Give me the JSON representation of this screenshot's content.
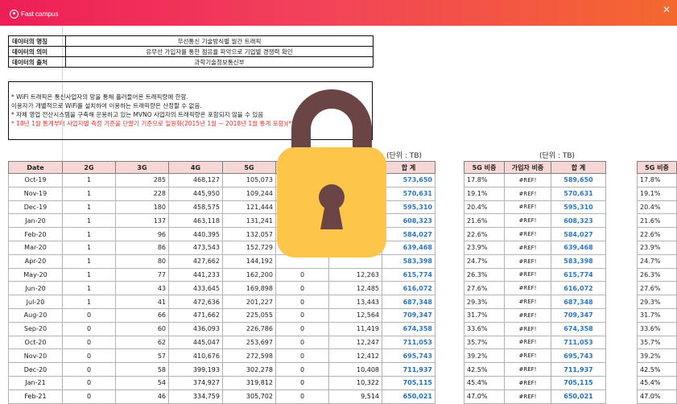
{
  "header": {
    "brand": "Fast campus",
    "close_glyph": "✕",
    "colors": {
      "start": "#ee1e58",
      "end": "#f4682f"
    }
  },
  "info": [
    {
      "key": "데이터의 명칭",
      "value": "무선통신 기술방식별 월간 트래픽"
    },
    {
      "key": "데이터의 의미",
      "value": "유무선 가입자를 통한 점유율 파악으로 기업별 경쟁력 확인"
    },
    {
      "key": "데이터의 출처",
      "value": "과학기술정보통신부"
    }
  ],
  "notes": {
    "line1": "* WiFi 트래픽은 통신사업자의 망을 통해 흘러들어온 트래픽량에 한함.",
    "line2": "이용자가 개별적으로 WiFi를 설치하여 이용하는 트래픽량은 산정할 수 없음.",
    "line3": "* 자체 영업 전산시스템을 구축해 운용하고 있는 MVNO 사업자의 트래픽량은 포함되지 않을 수 있음",
    "line4": "* 18년 1월 통계부터 사업자별 측정 기준을 단말기 기준으로 일원화(2015년 1월 ~ 2018년 1월 통계 포함)(*8)"
  },
  "units": {
    "u1": "(단위 : TB)",
    "u2": "(단위 : TB)"
  },
  "table1": {
    "headers": [
      "Date",
      "2G",
      "3G",
      "4G",
      "5G",
      "",
      "",
      "합 계"
    ],
    "rows": [
      [
        "Oct-19",
        "1",
        "285",
        "468,127",
        "105,073",
        "",
        "",
        "573,650"
      ],
      [
        "Nov-19",
        "1",
        "228",
        "445,950",
        "109,244",
        "",
        "",
        "570,631"
      ],
      [
        "Dec-19",
        "1",
        "180",
        "458,575",
        "121,444",
        "",
        "",
        "595,310"
      ],
      [
        "Jan-20",
        "1",
        "137",
        "463,118",
        "131,241",
        "",
        "",
        "608,323"
      ],
      [
        "Feb-20",
        "1",
        "96",
        "440,395",
        "132,057",
        "",
        "",
        "584,027"
      ],
      [
        "Mar-20",
        "1",
        "86",
        "473,543",
        "152,729",
        "",
        "",
        "639,468"
      ],
      [
        "Apr-20",
        "1",
        "80",
        "427,662",
        "144,192",
        "",
        "",
        "583,398"
      ],
      [
        "May-20",
        "1",
        "77",
        "441,233",
        "162,200",
        "0",
        "12,263",
        "615,774"
      ],
      [
        "Jun-20",
        "1",
        "43",
        "433,645",
        "169,898",
        "0",
        "12,485",
        "616,072"
      ],
      [
        "Jul-20",
        "1",
        "41",
        "472,636",
        "201,227",
        "0",
        "13,443",
        "687,348"
      ],
      [
        "Aug-20",
        "0",
        "66",
        "471,662",
        "225,055",
        "0",
        "12,564",
        "709,347"
      ],
      [
        "Sep-20",
        "0",
        "60",
        "436,093",
        "226,786",
        "0",
        "11,419",
        "674,358"
      ],
      [
        "Oct-20",
        "0",
        "62",
        "445,047",
        "253,697",
        "0",
        "12,247",
        "711,053"
      ],
      [
        "Nov-20",
        "0",
        "57",
        "410,676",
        "272,598",
        "0",
        "12,412",
        "695,743"
      ],
      [
        "Dec-20",
        "0",
        "58",
        "399,193",
        "302,278",
        "0",
        "10,408",
        "711,937"
      ],
      [
        "Jan-21",
        "0",
        "54",
        "374,927",
        "319,812",
        "0",
        "10,322",
        "705,115"
      ],
      [
        "Feb-21",
        "0",
        "46",
        "334,759",
        "305,702",
        "0",
        "9,514",
        "650,021"
      ]
    ]
  },
  "table2": {
    "headers": [
      "5G 비중",
      "가입자 비중",
      "합 계"
    ],
    "rows": [
      [
        "17.8%",
        "#REF!",
        "589,650"
      ],
      [
        "19.1%",
        "#REF!",
        "570,631"
      ],
      [
        "20.4%",
        "#REF!",
        "595,310"
      ],
      [
        "21.6%",
        "#REF!",
        "608,323"
      ],
      [
        "22.6%",
        "#REF!",
        "584,027"
      ],
      [
        "23.9%",
        "#REF!",
        "639,468"
      ],
      [
        "24.7%",
        "#REF!",
        "583,398"
      ],
      [
        "26.3%",
        "#REF!",
        "615,774"
      ],
      [
        "27.6%",
        "#REF!",
        "616,072"
      ],
      [
        "29.3%",
        "#REF!",
        "687,348"
      ],
      [
        "31.7%",
        "#REF!",
        "709,347"
      ],
      [
        "33.6%",
        "#REF!",
        "674,358"
      ],
      [
        "35.7%",
        "#REF!",
        "711,053"
      ],
      [
        "39.2%",
        "#REF!",
        "695,743"
      ],
      [
        "42.5%",
        "#REF!",
        "711,937"
      ],
      [
        "45.4%",
        "#REF!",
        "705,115"
      ],
      [
        "47.0%",
        "#REF!",
        "650,021"
      ]
    ]
  },
  "table3": {
    "headers": [
      "5G 비중"
    ],
    "rows": [
      "17.8%",
      "19.1%",
      "20.4%",
      "21.6%",
      "22.6%",
      "23.9%",
      "24.7%",
      "26.3%",
      "27.6%",
      "29.3%",
      "31.7%",
      "33.6%",
      "35.7%",
      "39.2%",
      "42.5%",
      "45.4%",
      "47.0%"
    ]
  },
  "lock": {
    "icon": "lock-icon",
    "body_color": "#fdc54a",
    "shackle_color": "#6b4545"
  }
}
